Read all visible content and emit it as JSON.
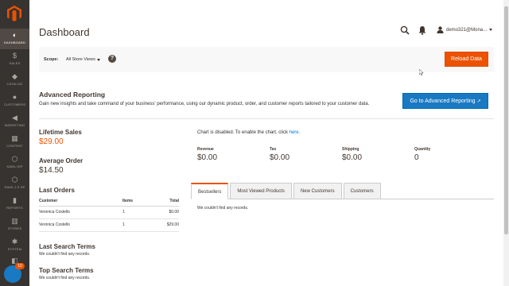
{
  "sidebar": {
    "logo": "magento-logo-icon",
    "items": [
      {
        "label": "DASHBOARD",
        "icon": "speedometer-icon",
        "glyph": "◐",
        "active": true
      },
      {
        "label": "SALES",
        "icon": "dollar-icon",
        "glyph": "$"
      },
      {
        "label": "CATALOG",
        "icon": "cube-icon",
        "glyph": "◆"
      },
      {
        "label": "CUSTOMERS",
        "icon": "person-icon",
        "glyph": "●"
      },
      {
        "label": "MARKETING",
        "icon": "megaphone-icon",
        "glyph": "◀"
      },
      {
        "label": "CONTENT",
        "icon": "layout-icon",
        "glyph": "▦"
      },
      {
        "label": "SAML IDP",
        "icon": "hexagon-icon",
        "glyph": "⬡"
      },
      {
        "label": "SAML 2.0 SP",
        "icon": "hexagon-icon",
        "glyph": "⬡"
      },
      {
        "label": "REPORTS",
        "icon": "bar-chart-icon",
        "glyph": "▮"
      },
      {
        "label": "STORES",
        "icon": "store-icon",
        "glyph": "▥"
      },
      {
        "label": "SYSTEM",
        "icon": "gear-icon",
        "glyph": "✱"
      },
      {
        "label": "",
        "icon": "box-icon",
        "glyph": "◧"
      }
    ],
    "chat_badge": "10"
  },
  "header": {
    "title": "Dashboard",
    "user": "demo321@Mona...",
    "search_icon": "search-icon",
    "bell_icon": "bell-icon"
  },
  "scope": {
    "label": "Scope:",
    "value": "All Store Views",
    "help": "?",
    "reload_label": "Reload Data"
  },
  "advanced_reporting": {
    "title": "Advanced Reporting",
    "description": "Gain new insights and take command of your business' performance, using our dynamic product, order, and customer reports tailored to your customer data.",
    "button_label": "Go to Advanced Reporting"
  },
  "stats": {
    "lifetime_sales_label": "Lifetime Sales",
    "lifetime_sales_value": "$29.00",
    "avg_order_label": "Average Order",
    "avg_order_value": "$14.50"
  },
  "last_orders": {
    "title": "Last Orders",
    "headers": {
      "customer": "Customer",
      "items": "Items",
      "total": "Total"
    },
    "rows": [
      {
        "customer": "Veronica Costello",
        "items": "1",
        "total": "$0.00"
      },
      {
        "customer": "Veronica Costello",
        "items": "1",
        "total": "$29.00"
      }
    ]
  },
  "last_search": {
    "title": "Last Search Terms",
    "note": "We couldn't find any records."
  },
  "top_search": {
    "title": "Top Search Terms",
    "note": "We couldn't find any records."
  },
  "chart": {
    "message": "Chart is disabled. To enable the chart, click ",
    "link": "here."
  },
  "totals": [
    {
      "label": "Revenue",
      "value": "$0.00",
      "highlight": true
    },
    {
      "label": "Tax",
      "value": "$0.00"
    },
    {
      "label": "Shipping",
      "value": "$0.00"
    },
    {
      "label": "Quantity",
      "value": "0"
    }
  ],
  "tabs": [
    {
      "label": "Bestsellers",
      "active": true
    },
    {
      "label": "Most Viewed Products"
    },
    {
      "label": "New Customers"
    },
    {
      "label": "Customers"
    }
  ],
  "tab_content": "We couldn't find any records.",
  "colors": {
    "accent": "#eb5202",
    "primary": "#1979c3",
    "sidebar": "#373330"
  }
}
